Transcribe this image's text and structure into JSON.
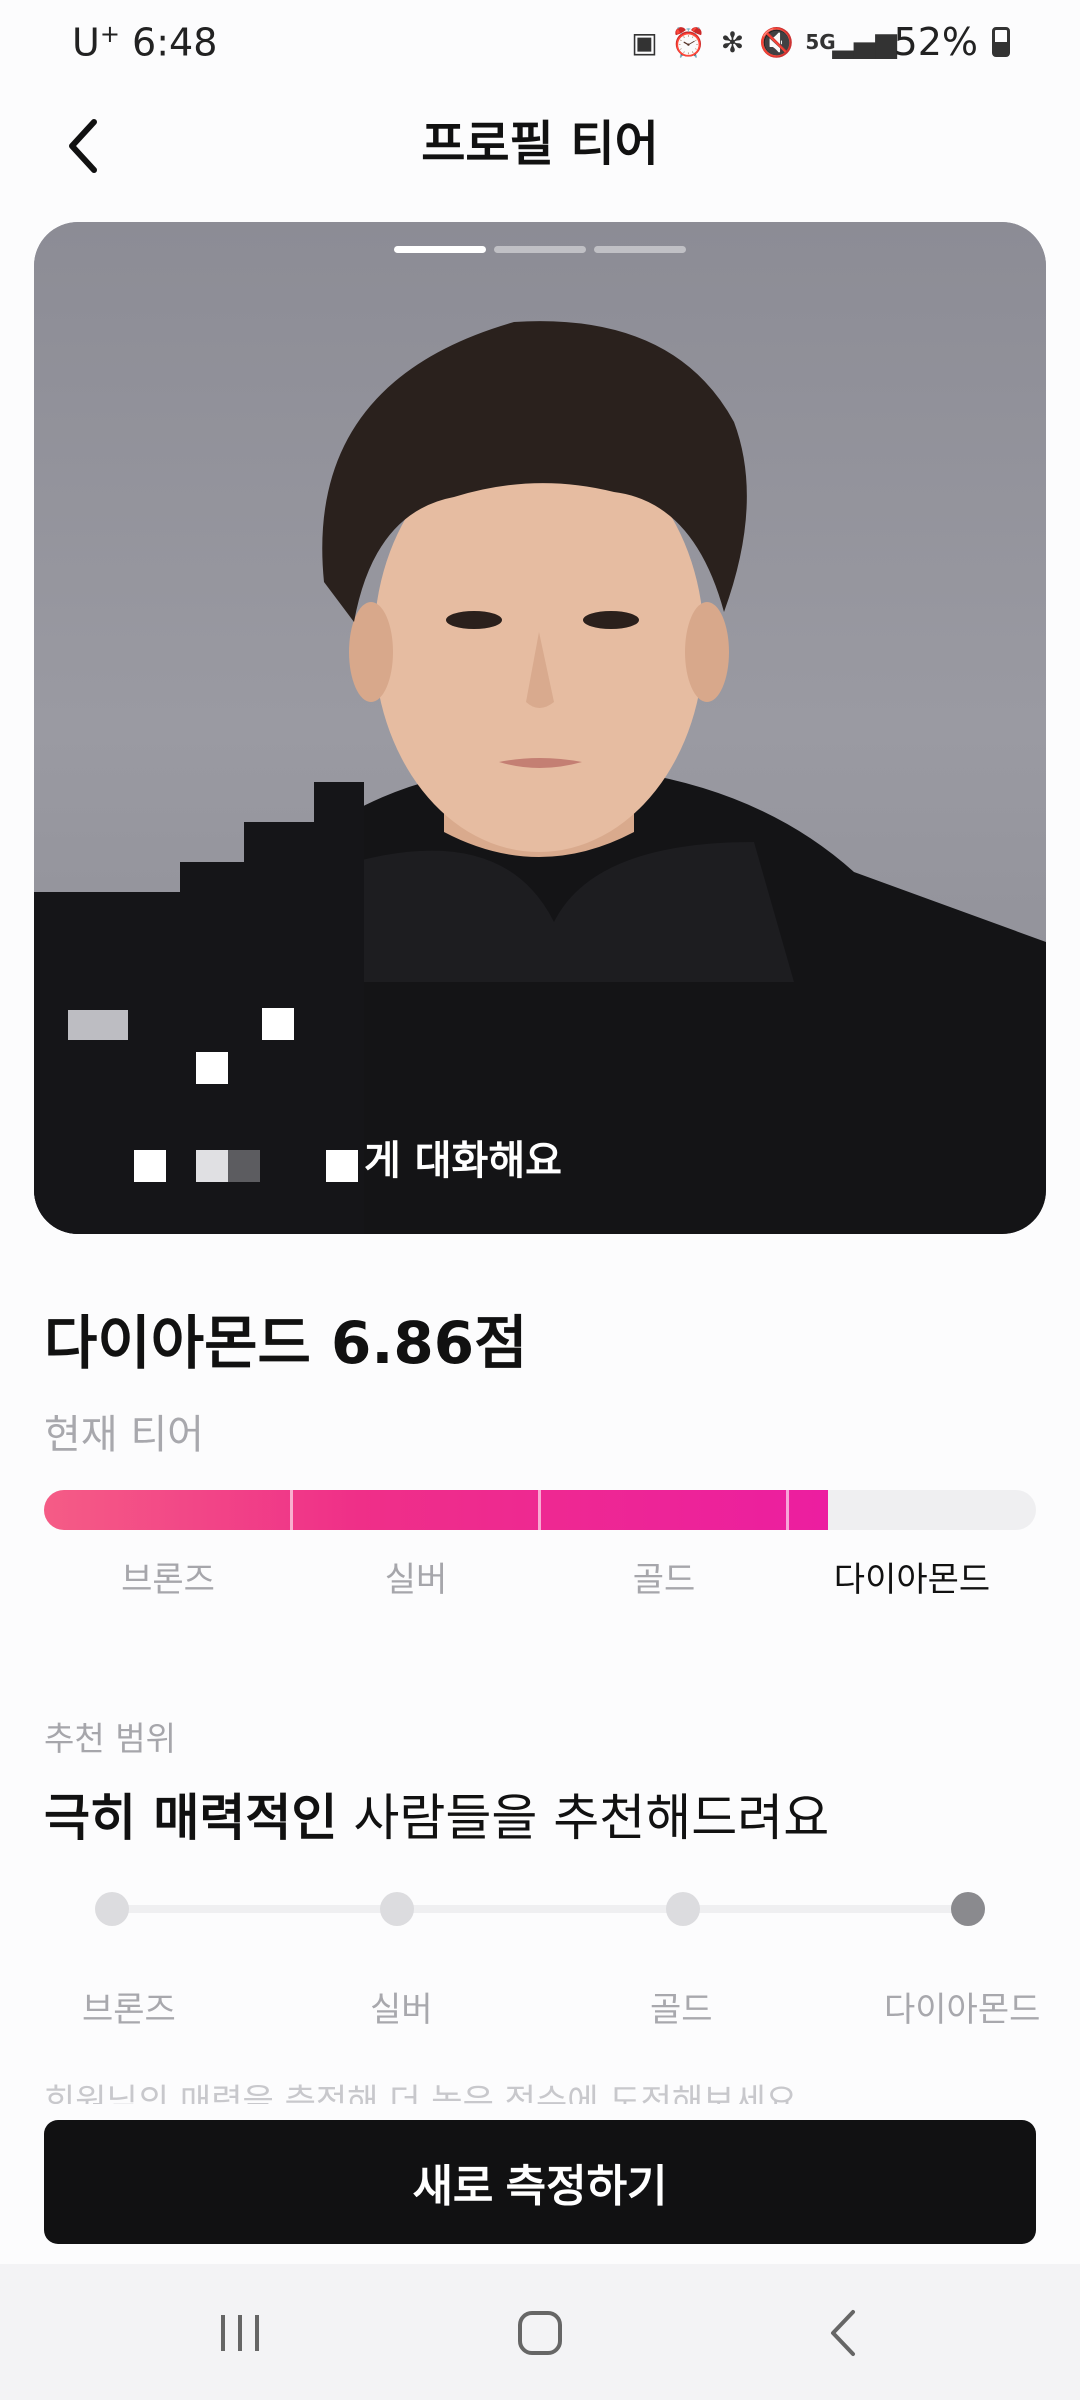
{
  "status_bar": {
    "carrier": "U",
    "carrier_sup": "+",
    "time": "6:48",
    "network": "5G",
    "battery": "52%"
  },
  "header": {
    "title": "프로필 티어"
  },
  "photo": {
    "caption": "게 대화해요",
    "pager_count": 3,
    "pager_active": 0
  },
  "tier": {
    "title": "다이아몬드 6.86점",
    "subtitle": "현재 티어",
    "progress": 0.79,
    "levels": [
      "브론즈",
      "실버",
      "골드",
      "다이아몬드"
    ],
    "current_level_index": 3,
    "colors": {
      "fill_start": "#f55c86",
      "fill_end": "#ec1ea0",
      "track": "#efeff1"
    }
  },
  "recommend": {
    "label": "추천 범위",
    "heading_bold": "극히 매력적인",
    "heading_rest": " 사람들을 추천해드려요",
    "levels": [
      "브론즈",
      "실버",
      "골드",
      "다이아몬드"
    ],
    "selected_index": 3,
    "note": "회원님의 매력을 측정해 더 높은 점수에 도전해보세요"
  },
  "action": {
    "measure_label": "새로 측정하기"
  },
  "nav": {
    "recent": "recent-apps-icon",
    "home": "home-icon",
    "back": "back-icon"
  }
}
